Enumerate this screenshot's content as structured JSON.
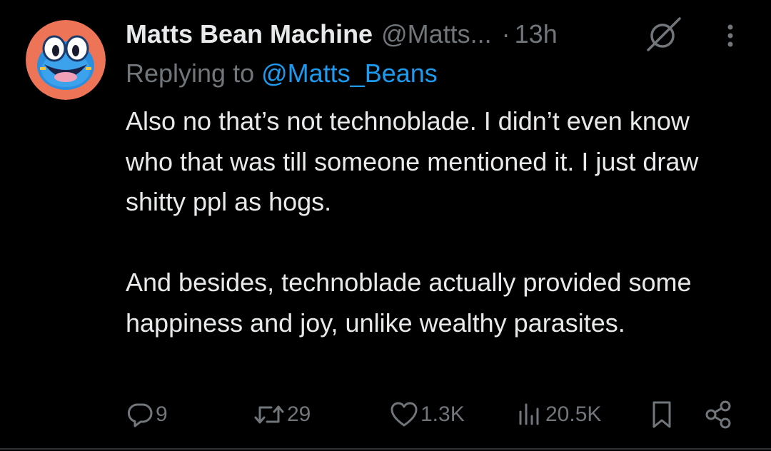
{
  "author": {
    "display_name": "Matts Bean Machine",
    "handle": "@Matts...",
    "separator": "·",
    "timestamp": "13h"
  },
  "reply_context": {
    "prefix": "Replying to",
    "mention": "@Matts_Beans"
  },
  "body": {
    "paragraph_1": "Also no that’s not technoblade. I didn’t even know who that was till someone mentioned it. I just draw shitty ppl as hogs.",
    "paragraph_2": "And besides, technoblade actually provided some happiness and joy, unlike wealthy parasites."
  },
  "actions": {
    "replies": "9",
    "reposts": "29",
    "likes": "1.3K",
    "views": "20.5K"
  },
  "icons": {
    "avatar": "frog-character-avatar",
    "grok": "grok-icon",
    "more": "more-vertical-icon",
    "reply": "reply-icon",
    "repost": "repost-icon",
    "like": "heart-icon",
    "views": "views-icon",
    "bookmark": "bookmark-icon",
    "share": "share-icon"
  },
  "colors": {
    "background": "#000000",
    "text_primary": "#e7e9ea",
    "text_secondary": "#71767b",
    "link": "#1d9bf0",
    "avatar_bg": "#ee7457",
    "avatar_face": "#2b8fe0"
  }
}
